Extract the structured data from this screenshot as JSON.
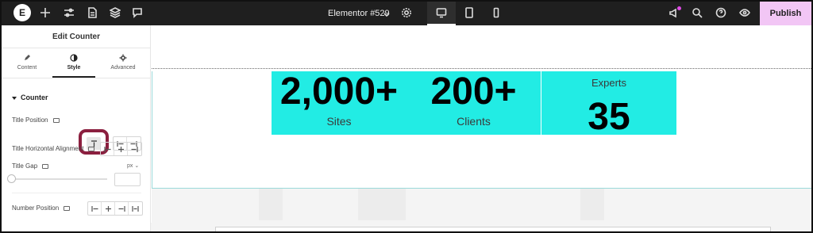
{
  "topbar": {
    "logo_text": "E",
    "document_title": "Elementor #529",
    "publish_label": "Publish",
    "icons": [
      "plus-icon",
      "sliders-icon",
      "page-icon",
      "layers-icon",
      "comments-icon",
      "settings-icon",
      "desktop-icon",
      "tablet-icon",
      "mobile-icon",
      "megaphone-icon",
      "search-icon",
      "help-icon",
      "eye-icon"
    ]
  },
  "panel": {
    "title": "Edit Counter",
    "tabs": [
      {
        "label": "Content",
        "icon": "pencil-icon"
      },
      {
        "label": "Style",
        "icon": "contrast-icon",
        "active": true
      },
      {
        "label": "Advanced",
        "icon": "gear-icon"
      }
    ],
    "section": "Counter",
    "controls": {
      "title_position": "Title Position",
      "title_horizontal_alignment": "Title Horizontal Alignment",
      "title_gap": "Title Gap",
      "title_gap_unit": "px",
      "number_position": "Number Position"
    }
  },
  "canvas": {
    "counters": [
      {
        "number": "2,000+",
        "title": "Sites"
      },
      {
        "number": "200+",
        "title": "Clients"
      },
      {
        "number": "35",
        "title": "Experts"
      }
    ]
  },
  "colors": {
    "topbar_bg": "#1f1f1f",
    "publish_bg": "#f2c6f5",
    "counter_bg": "#22ece4",
    "highlight_ring": "#8b1f3f"
  }
}
